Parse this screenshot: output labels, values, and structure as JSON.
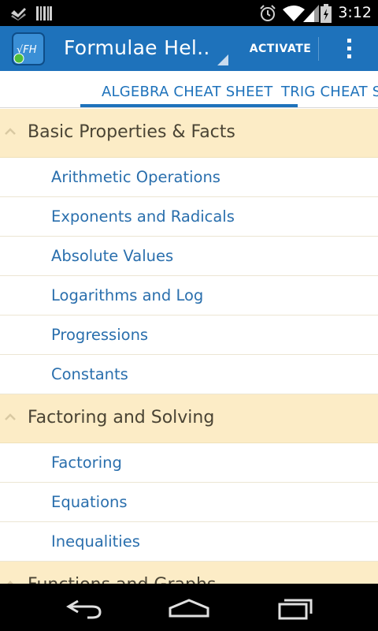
{
  "status_bar": {
    "time": "3:12",
    "icons": [
      "check-icon",
      "barcode-icon",
      "alarm-icon",
      "wifi-icon",
      "signal-icon",
      "battery-icon"
    ]
  },
  "action_bar": {
    "app_icon_text": "√FH",
    "title": "Formulae Hel..",
    "activate_label": "ACTIVATE",
    "color": "#1e72bb"
  },
  "tabs": [
    {
      "label": "ALGEBRA CHEAT SHEET",
      "selected": true
    },
    {
      "label": "TRIG CHEAT S",
      "selected": false
    }
  ],
  "groups": [
    {
      "title": "Basic Properties & Facts",
      "expanded": true,
      "items": [
        "Arithmetic Operations",
        "Exponents and Radicals",
        "Absolute Values",
        "Logarithms and Log",
        "Progressions",
        "Constants"
      ]
    },
    {
      "title": "Factoring and Solving",
      "expanded": true,
      "items": [
        "Factoring",
        "Equations",
        "Inequalities"
      ]
    },
    {
      "title": "Functions and Graphs",
      "expanded": true,
      "items": []
    }
  ],
  "nav": [
    "back-icon",
    "home-icon",
    "recent-apps-icon"
  ]
}
